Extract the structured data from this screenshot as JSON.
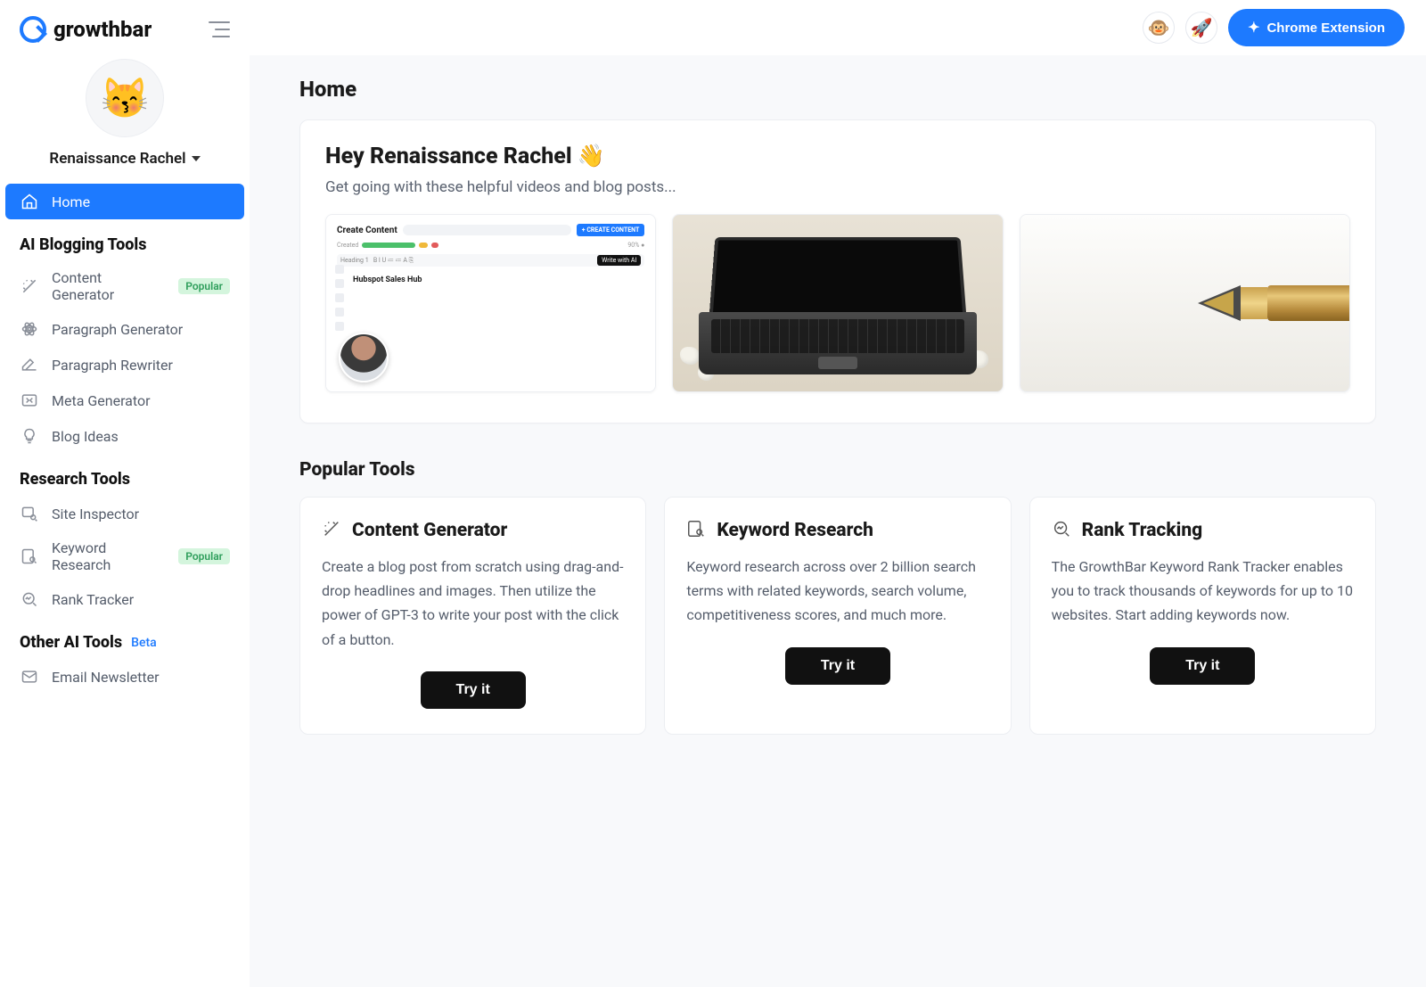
{
  "brand": "growthbar",
  "user": {
    "display_name": "Renaissance Rachel",
    "avatar_emoji": "😽"
  },
  "topbar": {
    "emoji_buttons": [
      "🐵",
      "🚀"
    ],
    "chrome_ext_label": "Chrome Extension"
  },
  "sidebar": {
    "home_label": "Home",
    "sections": [
      {
        "title": "AI Blogging Tools",
        "beta": false,
        "items": [
          {
            "label": "Content Generator",
            "badge": "Popular"
          },
          {
            "label": "Paragraph Generator",
            "badge": null
          },
          {
            "label": "Paragraph Rewriter",
            "badge": null
          },
          {
            "label": "Meta Generator",
            "badge": null
          },
          {
            "label": "Blog Ideas",
            "badge": null
          }
        ]
      },
      {
        "title": "Research Tools",
        "beta": false,
        "items": [
          {
            "label": "Site Inspector",
            "badge": null
          },
          {
            "label": "Keyword Research",
            "badge": "Popular"
          },
          {
            "label": "Rank Tracker",
            "badge": null
          }
        ]
      },
      {
        "title": "Other AI Tools",
        "beta": true,
        "beta_label": "Beta",
        "items": [
          {
            "label": "Email Newsletter",
            "badge": null
          }
        ]
      }
    ]
  },
  "page": {
    "title": "Home",
    "welcome_title": "Hey Renaissance Rachel 👋",
    "welcome_sub": "Get going with these helpful videos and blog posts...",
    "editor_mock": {
      "title": "Create Content",
      "create_btn": "+ CREATE CONTENT",
      "write_btn": "Write with AI",
      "sample_heading": "Hubspot Sales Hub"
    },
    "popular_title": "Popular Tools",
    "tools": [
      {
        "title": "Content Generator",
        "desc": "Create a blog post from scratch using drag-and-drop headlines and images. Then utilize the power of GPT-3 to write your post with the click of a button.",
        "cta": "Try it"
      },
      {
        "title": "Keyword Research",
        "desc": "Keyword research across over 2 billion search terms with related keywords, search volume, competitiveness scores, and much more.",
        "cta": "Try it"
      },
      {
        "title": "Rank Tracking",
        "desc": "The GrowthBar Keyword Rank Tracker enables you to track thousands of keywords for up to 10 websites. Start adding keywords now.",
        "cta": "Try it"
      }
    ]
  }
}
